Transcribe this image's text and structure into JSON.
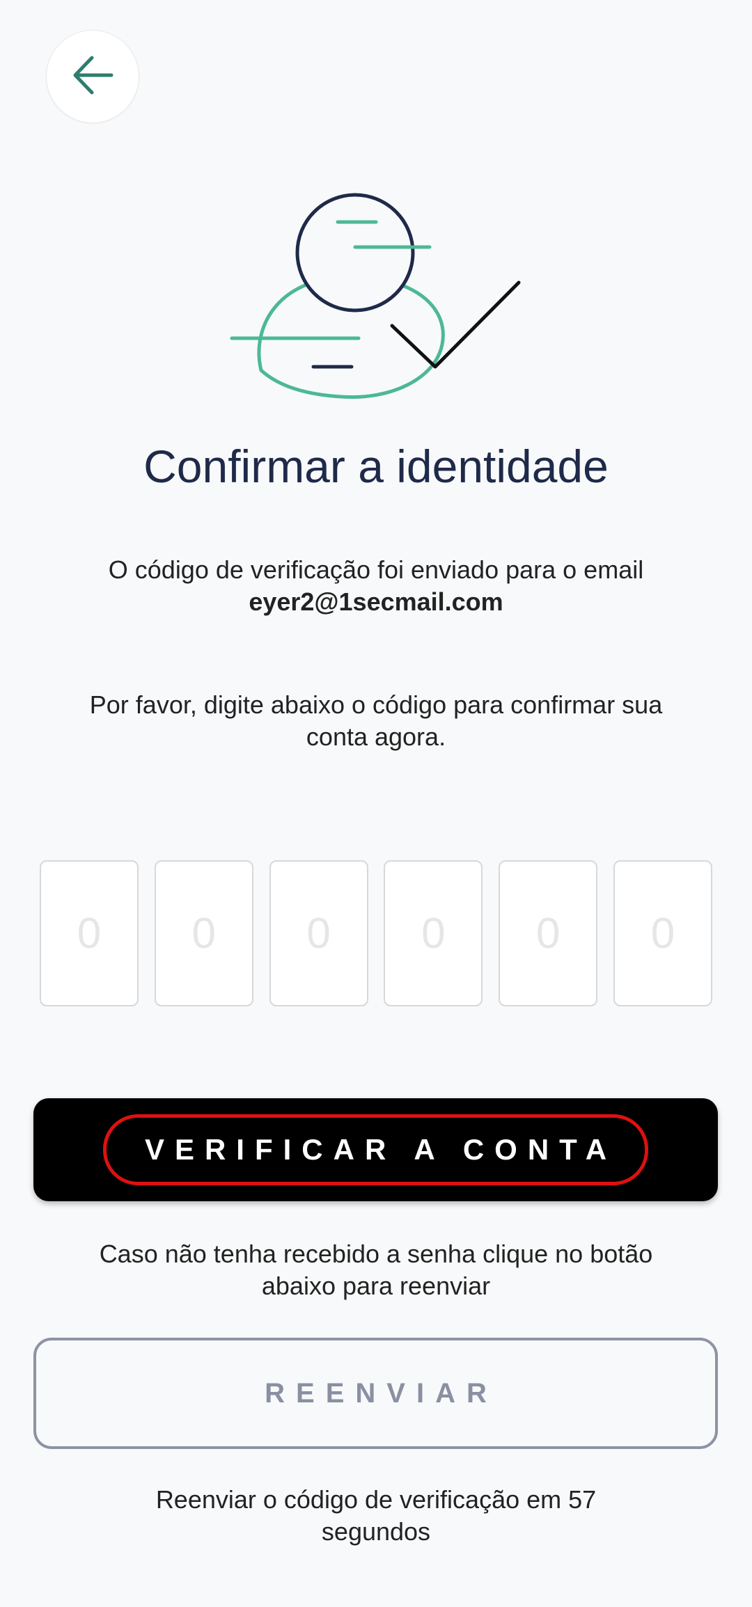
{
  "header": {
    "back_icon": "arrow-left-icon",
    "accent_color": "#2e7d6f"
  },
  "illustration": {
    "icon": "user-check-icon",
    "primary_color": "#1f2a4a",
    "accent_color": "#4cb896"
  },
  "title": "Confirmar a identidade",
  "info": {
    "line1": "O código de verificação foi enviado para o email",
    "email": "eyer2@1secmail.com"
  },
  "instruction": "Por favor, digite abaixo o código para confirmar sua conta agora.",
  "code_inputs": {
    "placeholders": [
      "0",
      "0",
      "0",
      "0",
      "0",
      "0"
    ]
  },
  "verify_button": {
    "label": "VERIFICAR A CONTA"
  },
  "resend_hint": "Caso não tenha recebido a senha clique no botão abaixo para reenviar",
  "resend_button": {
    "label": "REENVIAR"
  },
  "countdown": "Reenviar o código de verificação em 57 segundos"
}
